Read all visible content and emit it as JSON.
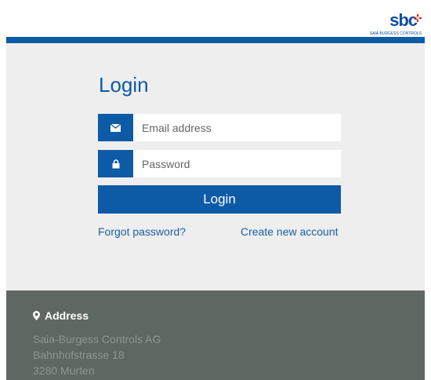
{
  "brand": {
    "logo_text": "sbc",
    "logo_sub": "SAIA BURGESS CONTROLS",
    "primary": "#0d5aa7",
    "footer_bg": "#5f6762"
  },
  "login": {
    "title": "Login",
    "email_placeholder": "Email address",
    "password_placeholder": "Password",
    "button_label": "Login",
    "forgot_label": "Forgot password?",
    "create_label": "Create new account"
  },
  "footer": {
    "address_heading": "Address",
    "lines": [
      "Saia-Burgess Controls AG",
      "Bahnhofstrasse 18",
      "3280 Murten"
    ]
  }
}
